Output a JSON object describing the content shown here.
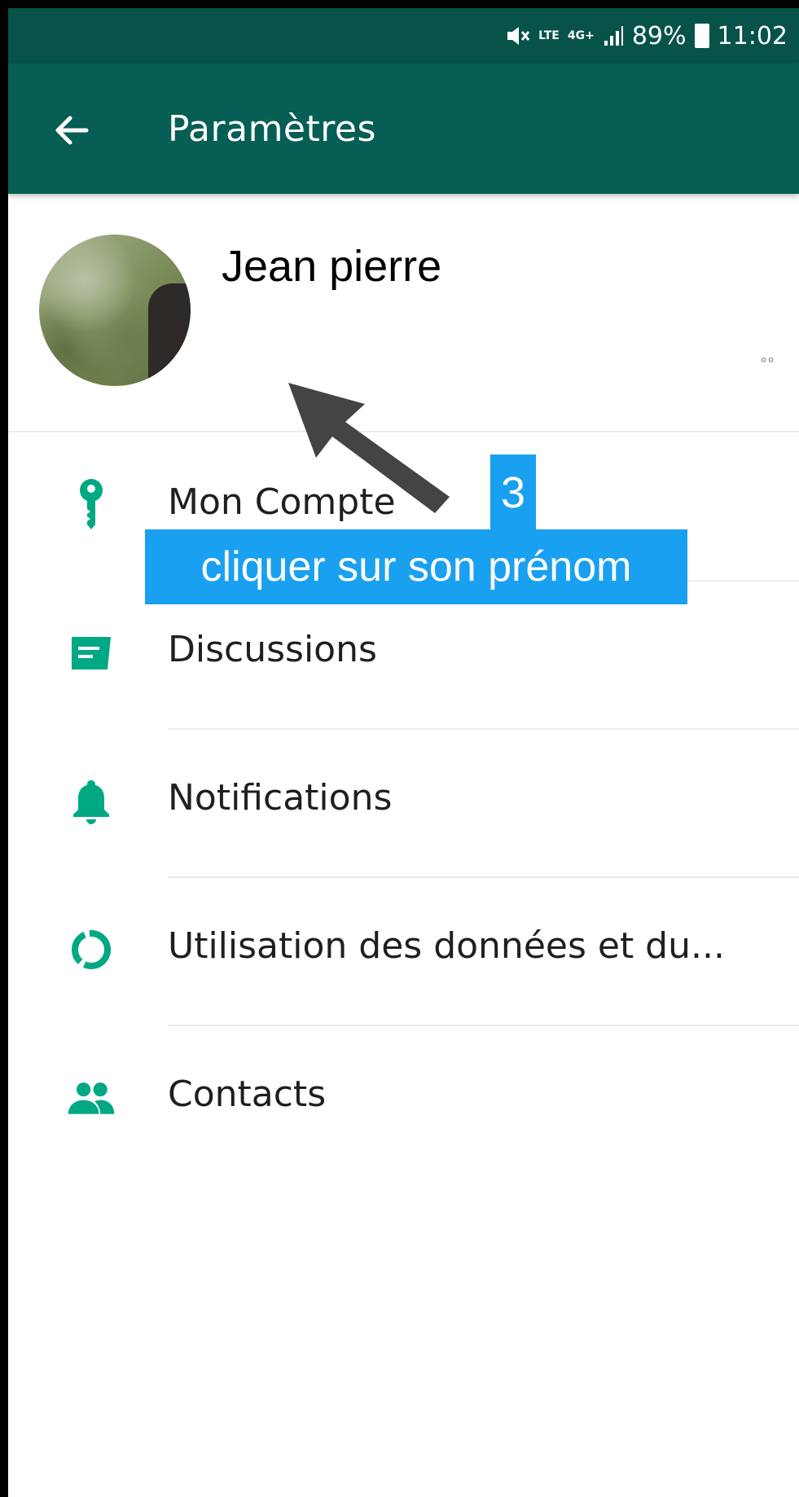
{
  "status_bar": {
    "network_lte": "LTE",
    "network_4g": "4G+",
    "battery": "89%",
    "time": "11:02"
  },
  "app_bar": {
    "title": "Paramètres"
  },
  "profile": {
    "name": "Jean pierre",
    "status": "°°"
  },
  "menu": {
    "items": [
      {
        "label": "Mon Compte",
        "icon": "key-icon"
      },
      {
        "label": "Discussions",
        "icon": "chat-icon"
      },
      {
        "label": "Notifications",
        "icon": "bell-icon"
      },
      {
        "label": "Utilisation des données et du...",
        "icon": "data-usage-icon"
      },
      {
        "label": "Contacts",
        "icon": "contacts-icon"
      }
    ]
  },
  "annotation": {
    "step": "3",
    "instruction": "cliquer sur son prénom"
  },
  "colors": {
    "status_bar": "#07534a",
    "app_bar": "#075e54",
    "accent_icon": "#00a884",
    "annotation": "#1aa0f0"
  }
}
